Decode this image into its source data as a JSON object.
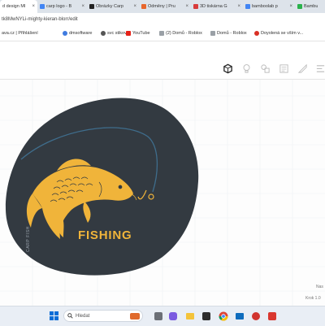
{
  "browser": {
    "tabs": [
      {
        "title": "d design MI",
        "favicon_color": "#e0453a",
        "active": true
      },
      {
        "title": "carp logo - B",
        "favicon_color": "#4285f4",
        "active": false
      },
      {
        "title": "Obrázky Carp",
        "favicon_color": "#222222",
        "active": false
      },
      {
        "title": "Odměny | Pru",
        "favicon_color": "#e8662c",
        "active": false
      },
      {
        "title": "3D tiskárna G",
        "favicon_color": "#d83b3b",
        "active": false
      },
      {
        "title": "bamboolab p",
        "favicon_color": "#4285f4",
        "active": false
      },
      {
        "title": "Bambu",
        "favicon_color": "#2bb24c",
        "active": false
      }
    ],
    "url": "tk8MwNYLi-mighty-kieran-blorr/edit",
    "bookmarks": [
      {
        "label": "ava.cz | Přihlášení",
        "favicon_color": "#3b82c4"
      },
      {
        "label": "dmsoftware",
        "favicon_color": "#3f7be0"
      },
      {
        "label": "svc stikov",
        "favicon_color": "#555555"
      },
      {
        "label": "YouTube",
        "favicon_color": "#e62117"
      },
      {
        "label": "(2) Domů - Roblox",
        "favicon_color": "#9aa0a6"
      },
      {
        "label": "Domů - Roblox",
        "favicon_color": "#9aa0a6"
      },
      {
        "label": "Doyolená se vším v...",
        "favicon_color": "#d93025"
      }
    ]
  },
  "toolbar": {
    "icons": [
      "view-cube-icon",
      "lightbulb-icon",
      "shapes-icon",
      "note-icon",
      "ruler-icon",
      "align-icon",
      "mirror-icon"
    ]
  },
  "canvas": {
    "plate_color": "#333a41",
    "fish_color": "#f0b43a",
    "line_color": "#3f6d8c",
    "logo_text": "FISHING",
    "side_text": "CARP FISH",
    "settings_label": "Nas",
    "step_label": "Krok 1.0"
  },
  "taskbar": {
    "search_placeholder": "Hledat",
    "apps": [
      "windows-icon",
      "search-icon",
      "widget-icon",
      "gallery-icon",
      "chat-icon",
      "explorer-icon",
      "app-icon",
      "chrome-icon",
      "mail-icon",
      "media-icon",
      "more-icon"
    ]
  }
}
